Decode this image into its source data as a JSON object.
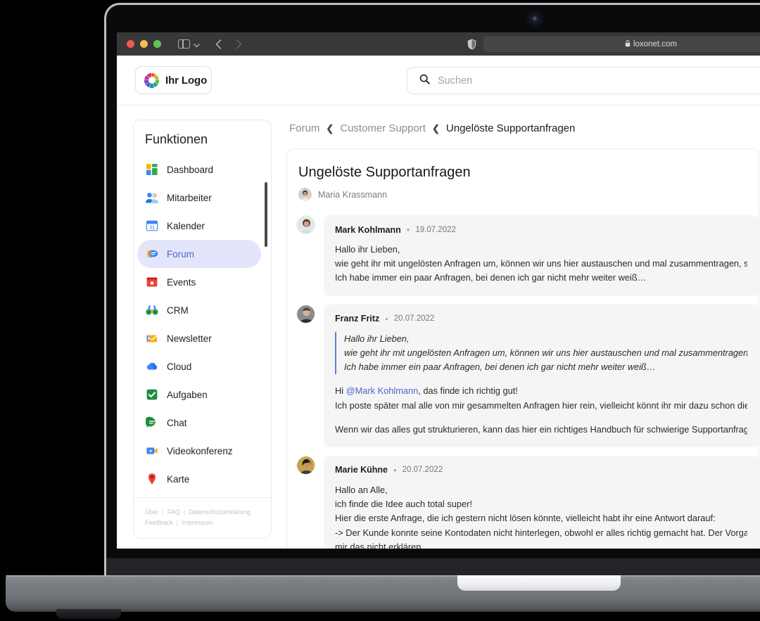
{
  "browser": {
    "url": "loxonet.com",
    "lock_icon": "lock-icon",
    "reload_icon": "reload-icon",
    "shield_icon": "shield-icon",
    "sidebar_toggle_icon": "sidebar-toggle-icon",
    "back_icon": "chevron-left-icon",
    "forward_icon": "chevron-right-icon"
  },
  "header": {
    "logo_text": "Ihr Logo",
    "logo_icon": "ring-logo-icon",
    "search": {
      "placeholder": "Suchen",
      "icon": "search-icon",
      "value": ""
    }
  },
  "sidebar": {
    "title": "Funktionen",
    "items": [
      {
        "label": "Dashboard",
        "icon": "dashboard-icon",
        "active": false
      },
      {
        "label": "Mitarbeiter",
        "icon": "people-icon",
        "active": false
      },
      {
        "label": "Kalender",
        "icon": "calendar-icon",
        "active": false
      },
      {
        "label": "Forum",
        "icon": "forum-chat-icon",
        "active": true
      },
      {
        "label": "Events",
        "icon": "events-icon",
        "active": false
      },
      {
        "label": "CRM",
        "icon": "binoculars-icon",
        "active": false
      },
      {
        "label": "Newsletter",
        "icon": "mail-icon",
        "active": false
      },
      {
        "label": "Cloud",
        "icon": "cloud-icon",
        "active": false
      },
      {
        "label": "Aufgaben",
        "icon": "checkbox-icon",
        "active": false
      },
      {
        "label": "Chat",
        "icon": "chat-bubble-icon",
        "active": false
      },
      {
        "label": "Videokonferenz",
        "icon": "video-icon",
        "active": false
      },
      {
        "label": "Karte",
        "icon": "map-pin-icon",
        "active": false
      }
    ],
    "footer_links_row1": [
      "Über",
      "FAQ",
      "Datenschutzerklärung"
    ],
    "footer_links_row2": [
      "Feedback",
      "Impressum"
    ],
    "separator": "|"
  },
  "breadcrumb": {
    "items": [
      "Forum",
      "Customer Support",
      "Ungelöste Supportanfragen"
    ],
    "separator": "❮"
  },
  "thread": {
    "title": "Ungelöste Supportanfragen",
    "author": "Maria Krassmann",
    "author_avatar": "avatar-maria-krassmann",
    "posts": [
      {
        "author": "Mark Kohlmann",
        "avatar": "avatar-mark-kohlmann",
        "bullet": "•",
        "date": "19.07.2022",
        "text": "Hallo ihr Lieben,\nwie geht ihr mit ungelösten Anfragen um, können wir uns hier austauschen und mal zusammentragen, so können w\nIch habe immer ein paar Anfragen, bei denen ich gar nicht mehr weiter weiß…"
      },
      {
        "author": "Franz Fritz",
        "avatar": "avatar-franz-fritz",
        "bullet": "•",
        "date": "20.07.2022",
        "quote": "Hallo ihr Lieben,\nwie geht ihr mit ungelösten Anfragen um, können wir uns hier austauschen und mal zusammentragen, so können\nIch habe immer ein paar Anfragen, bei denen ich gar nicht mehr weiter weiß…",
        "reply_prefix": "Hi ",
        "mention": "@Mark Kohlmann",
        "reply_rest": ", das finde ich richtig gut!\nIch poste später mal alle von mir gesammelten Anfragen hier rein, vielleicht könnt ihr mir dazu schon die Antworten",
        "text2": "Wenn wir das alles gut strukturieren, kann das hier ein richtiges Handbuch für schwierige Supportanfragen werden."
      },
      {
        "author": "Marie Kühne",
        "avatar": "avatar-marie-kuehne",
        "bullet": "•",
        "date": "20.07.2022",
        "text": "Hallo an Alle,\nich finde die Idee auch total super!\nHier die erste Anfrage, die ich gestern nicht lösen könnte, vielleicht habt ihr eine Antwort darauf:\n-> Der Kunde konnte seine Kontodaten nicht hinterlegen, obwohl er alles richtig gemacht hat. Der Vorgang des Spe\nmir das nicht erklären."
      }
    ]
  },
  "colors": {
    "accent": "#5064cf",
    "active_bg": "#e3e6fb",
    "post_bg": "#f5f5f5",
    "quote_bar": "#5b7fd4",
    "chrome_bg": "#383838"
  }
}
